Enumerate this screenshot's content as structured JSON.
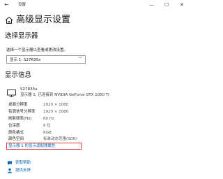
{
  "window": {
    "back": "←",
    "title": "设置",
    "min": "—",
    "max": "☐",
    "close": "✕"
  },
  "page": {
    "title": "高级显示设置"
  },
  "select_display": {
    "heading": "选择显示器",
    "instruction": "选择一个显示器以查看或更改设置。",
    "selected": "显示 1: S27R35x",
    "chevron": "﹀"
  },
  "display_info": {
    "heading": "显示信息",
    "monitor_name": "S27R35x",
    "monitor_connection": "显示器 1: 已连接到 NVIDIA GeForce GTX 1050 Ti",
    "rows": [
      {
        "key": "桌面分辨率",
        "value": "1920 × 1080"
      },
      {
        "key": "有源信号分辨率",
        "value": "1920 × 1080"
      },
      {
        "key": "刷新频率(Hz)",
        "value": "60 Hz"
      },
      {
        "key": "位深度",
        "value": "8 位"
      },
      {
        "key": "颜色格式",
        "value": "RGB"
      },
      {
        "key": "颜色空间",
        "value": "标准动态范围(SDR)"
      }
    ],
    "adapter_link": "显示器 1 的显示适配器属性"
  },
  "footer": {
    "help": "获取帮助",
    "feedback": "提供反馈"
  },
  "icons": {
    "home": "home-icon",
    "monitor": "monitor-icon",
    "help": "help-icon",
    "feedback": "feedback-icon"
  },
  "colors": {
    "link": "#0067b8",
    "highlight_box": "#e23b3b"
  }
}
